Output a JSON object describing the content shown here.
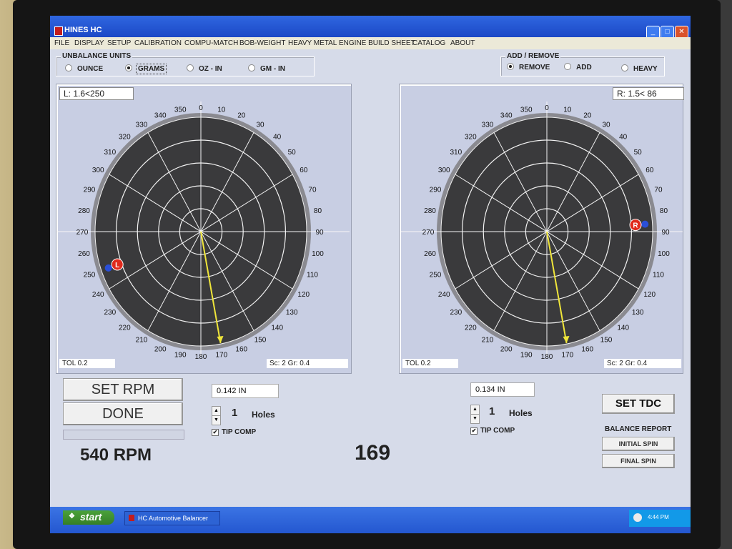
{
  "window": {
    "title": "HINES HC",
    "min": "_",
    "max": "□",
    "close": "✕"
  },
  "menu": [
    "FILE",
    "DISPLAY",
    "SETUP",
    "CALIBRATION",
    "COMPU-MATCH",
    "BOB-WEIGHT",
    "HEAVY METAL",
    "ENGINE BUILD SHEET",
    "CATALOG",
    "ABOUT"
  ],
  "unbalance_units": {
    "title": "UNBALANCE UNITS",
    "options": [
      "OUNCE",
      "GRAMS",
      "OZ - IN",
      "GM - IN"
    ],
    "selected": "GRAMS"
  },
  "add_remove": {
    "title": "ADD / REMOVE",
    "options": [
      "REMOVE",
      "ADD",
      "HEAVY"
    ],
    "selected": "REMOVE"
  },
  "left_plane": {
    "readout": "L:   1.6<250",
    "marker": "L",
    "tol": "TOL   0.2",
    "scale": "Sc:   2 Gr:  0.4",
    "marker_angle": 250,
    "needle_angle": 170,
    "distance": "0.142 IN",
    "holes_count": "1",
    "holes_label": "Holes",
    "tip_comp": "TIP COMP",
    "tip_comp_checked": true
  },
  "right_plane": {
    "readout": "R:   1.5< 86",
    "marker": "R",
    "tol": "TOL   0.2",
    "scale": "Sc:   2 Gr:  0.4",
    "marker_angle": 86,
    "needle_angle": 170,
    "distance": "0.134 IN",
    "holes_count": "1",
    "holes_label": "Holes",
    "tip_comp": "TIP COMP",
    "tip_comp_checked": true
  },
  "angle_ticks": [
    0,
    10,
    20,
    30,
    40,
    50,
    60,
    70,
    80,
    90,
    100,
    110,
    120,
    130,
    140,
    150,
    160,
    170,
    180,
    190,
    200,
    210,
    220,
    230,
    240,
    250,
    260,
    270,
    280,
    290,
    300,
    310,
    320,
    330,
    340,
    350
  ],
  "buttons": {
    "set_rpm": "SET RPM",
    "done": "DONE",
    "set_tdc": "SET TDC",
    "balance_report": "BALANCE REPORT",
    "initial_spin": "INITIAL SPIN",
    "final_spin": "FINAL SPIN"
  },
  "rpm": "540 RPM",
  "center_value": "169",
  "taskbar": {
    "start": "start",
    "task": "HC Automotive Balancer",
    "time": "4:44 PM"
  },
  "colors": {
    "dial_bg": "#3a3a3c",
    "needle": "#f0e63a",
    "marker": "#e02a1c",
    "marker_blue": "#2a4fd8",
    "window_blue": "#2456d6"
  }
}
